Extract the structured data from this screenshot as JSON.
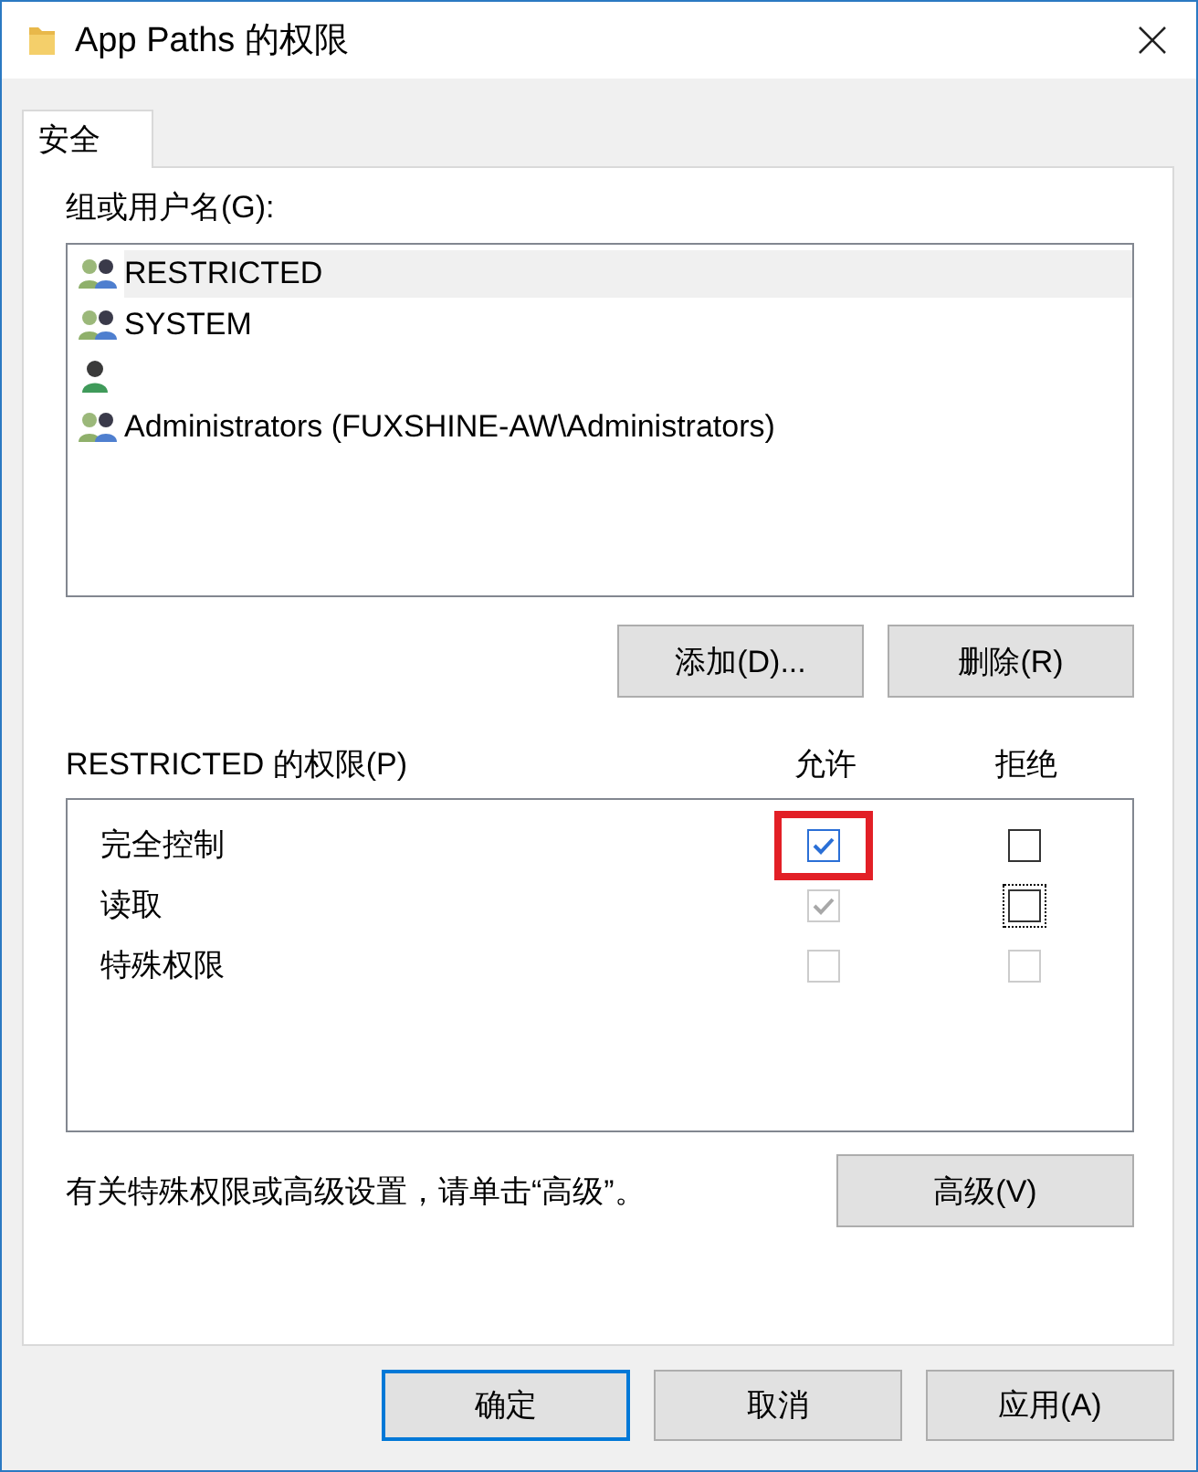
{
  "window": {
    "title": "App Paths 的权限"
  },
  "tabs": [
    {
      "label": "安全",
      "selected": true
    }
  ],
  "groups_label": "组或用户名(G):",
  "users": [
    {
      "name": "RESTRICTED",
      "kind": "group",
      "selected": true
    },
    {
      "name": "SYSTEM",
      "kind": "group",
      "selected": false
    },
    {
      "kind": "user",
      "selected": false
    },
    {
      "name": "Administrators (FUXSHINE-AW\\Administrators)",
      "kind": "group",
      "selected": false
    }
  ],
  "user_buttons": [
    "添加(D)...",
    "删除(R)"
  ],
  "permissions_label": "RESTRICTED 的权限(P)",
  "columns": [
    "允许",
    "拒绝"
  ],
  "permissions": [
    {
      "name": "完全控制",
      "allow": {
        "checked": true,
        "disabled": false,
        "highlighted": true
      },
      "deny": {
        "checked": false,
        "disabled": false,
        "focused": false
      }
    },
    {
      "name": "读取",
      "allow": {
        "checked": true,
        "disabled": true,
        "highlighted": false
      },
      "deny": {
        "checked": false,
        "disabled": false,
        "focused": true
      }
    },
    {
      "name": "特殊权限",
      "allow": {
        "checked": false,
        "disabled": true,
        "highlighted": false
      },
      "deny": {
        "checked": false,
        "disabled": true,
        "focused": false
      }
    }
  ],
  "hint": "有关特殊权限或高级设置，请单击“高级”。",
  "advanced_button": "高级(V)",
  "dialog_buttons": [
    {
      "label": "确定",
      "default": true
    },
    {
      "label": "取消",
      "default": false
    },
    {
      "label": "应用(A)",
      "default": false
    }
  ]
}
